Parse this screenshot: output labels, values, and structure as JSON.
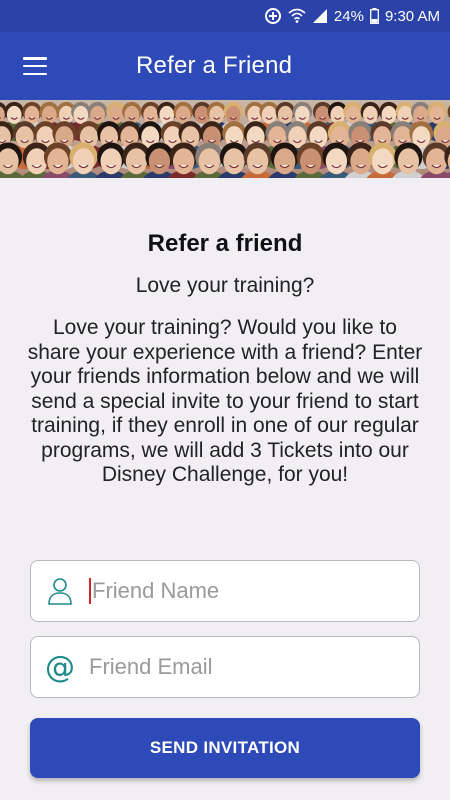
{
  "status_bar": {
    "battery": "24%",
    "time": "9:30 AM",
    "icons": [
      "data-saver-icon",
      "wifi-icon",
      "signal-icon",
      "battery-icon"
    ]
  },
  "app_bar": {
    "title": "Refer a Friend",
    "menu_icon": "hamburger-menu-icon",
    "color": "#2d4ab8"
  },
  "banner": {
    "image": "crowd-of-people-photo"
  },
  "main": {
    "heading": "Refer a friend",
    "subheading": "Love your training?",
    "description": "Love your training? Would you like to share your experience with a friend? Enter your friends information below and we will send a special invite to your friend to start training, if they enroll in one of our regular programs, we will add 3 Tickets into our Disney Challenge, for you!"
  },
  "form": {
    "name_placeholder": "Friend Name",
    "name_value": "",
    "name_icon": "person-icon",
    "email_placeholder": "Friend Email",
    "email_value": "",
    "email_icon": "at-sign-icon",
    "submit_label": "SEND INVITATION"
  },
  "colors": {
    "primary": "#2d4ab8",
    "icon_accent": "#1f8a8a",
    "background": "#f1eff3"
  }
}
